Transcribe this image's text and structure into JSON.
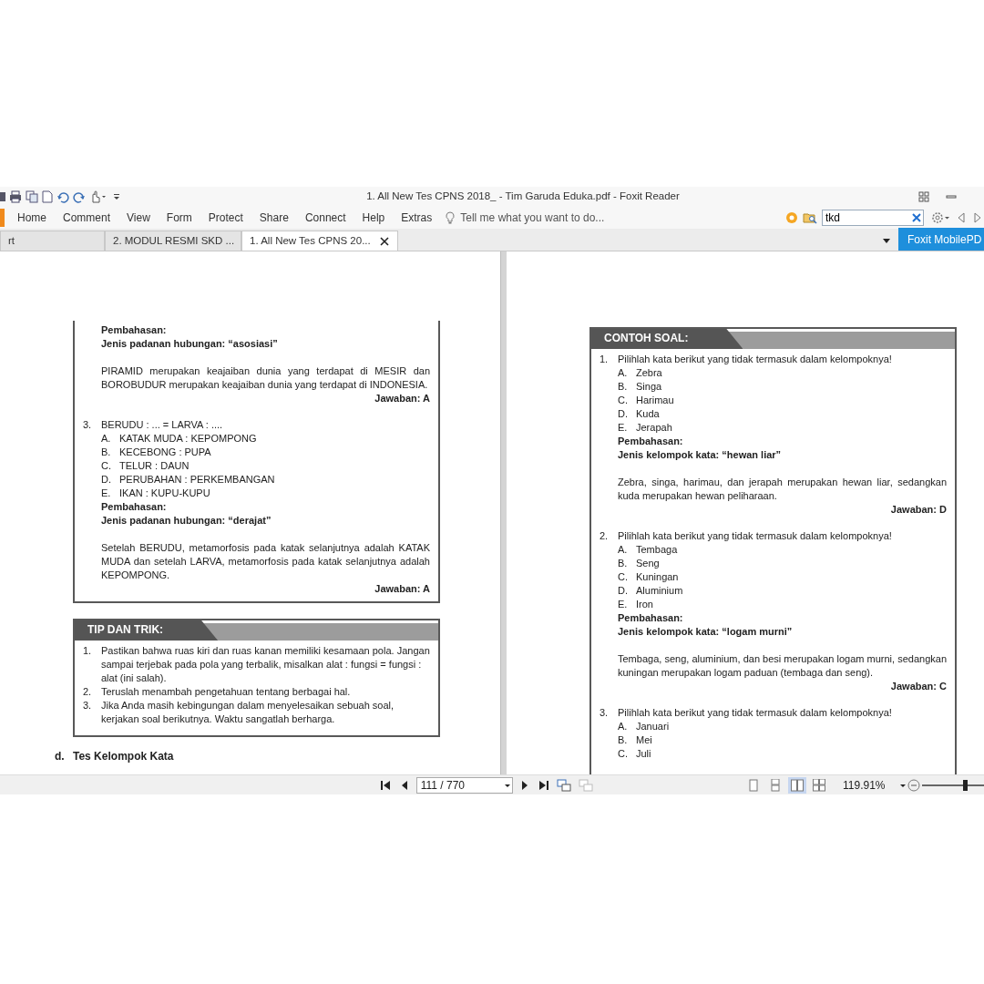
{
  "window": {
    "title": "1. All New Tes CPNS 2018_ - Tim Garuda Eduka.pdf - Foxit Reader"
  },
  "ribbon_tabs": [
    {
      "label": "Home"
    },
    {
      "label": "Comment"
    },
    {
      "label": "View"
    },
    {
      "label": "Form"
    },
    {
      "label": "Protect"
    },
    {
      "label": "Share"
    },
    {
      "label": "Connect"
    },
    {
      "label": "Help"
    },
    {
      "label": "Extras"
    }
  ],
  "tell_me": {
    "placeholder": "Tell me what you want to do..."
  },
  "search": {
    "value": "tkd"
  },
  "doc_tabs": [
    {
      "label": "rt",
      "selected": false
    },
    {
      "label": "2. MODUL RESMI SKD ...",
      "selected": false
    },
    {
      "label": "1. All New Tes CPNS 20...",
      "selected": true
    }
  ],
  "promo": "Foxit MobilePD",
  "left_page": {
    "boxes": [
      {
        "blocks": [
          {
            "kind": "label",
            "text": "Pembahasan:"
          },
          {
            "kind": "label",
            "text": "Jenis padanan hubungan: “asosiasi”"
          },
          {
            "kind": "para",
            "text": "PIRAMID merupakan keajaiban dunia yang terdapat di MESIR dan BOROBUDUR merupakan keajaiban dunia yang terdapat di INDONESIA."
          },
          {
            "kind": "answer",
            "text": "Jawaban: A"
          },
          {
            "kind": "question",
            "number": "3.",
            "text": "BERUDU : ... = LARVA : ...."
          },
          {
            "kind": "option",
            "letter": "A.",
            "text": "KATAK MUDA : KEPOMPONG"
          },
          {
            "kind": "option",
            "letter": "B.",
            "text": "KECEBONG : PUPA"
          },
          {
            "kind": "option",
            "letter": "C.",
            "text": "TELUR : DAUN"
          },
          {
            "kind": "option",
            "letter": "D.",
            "text": "PERUBAHAN : PERKEMBANGAN"
          },
          {
            "kind": "option",
            "letter": "E.",
            "text": "IKAN : KUPU-KUPU"
          },
          {
            "kind": "label",
            "text": "Pembahasan:"
          },
          {
            "kind": "label",
            "text": "Jenis padanan hubungan: “derajat”"
          },
          {
            "kind": "para",
            "text": "Setelah BERUDU, metamorfosis pada katak selanjutnya adalah KATAK MUDA dan setelah LARVA, metamorfosis pada katak selanjutnya adalah KEPOMPONG."
          },
          {
            "kind": "answer",
            "text": "Jawaban: A"
          }
        ]
      },
      {
        "header": "TIP DAN TRIK:",
        "blocks": [
          {
            "kind": "item",
            "number": "1.",
            "text": "Pastikan bahwa ruas kiri dan ruas kanan memiliki kesamaan pola. Jangan sampai terjebak pada pola yang terbalik, misalkan alat : fungsi = fungsi : alat (ini salah)."
          },
          {
            "kind": "item",
            "number": "2.",
            "text": "Teruslah menambah pengetahuan tentang berbagai hal."
          },
          {
            "kind": "item",
            "number": "3.",
            "text": "Jika Anda masih kebingungan dalam menyelesaikan sebuah soal, kerjakan soal berikutnya. Waktu sangatlah berharga."
          }
        ]
      }
    ],
    "section_heading": {
      "number": "d.",
      "text": "Tes Kelompok Kata"
    }
  },
  "right_page": {
    "boxes": [
      {
        "header": "CONTOH SOAL:",
        "blocks": [
          {
            "kind": "question",
            "number": "1.",
            "text": "Pilihlah kata berikut yang tidak termasuk dalam kelompoknya!"
          },
          {
            "kind": "option",
            "letter": "A.",
            "text": "Zebra"
          },
          {
            "kind": "option",
            "letter": "B.",
            "text": "Singa"
          },
          {
            "kind": "option",
            "letter": "C.",
            "text": "Harimau"
          },
          {
            "kind": "option",
            "letter": "D.",
            "text": "Kuda"
          },
          {
            "kind": "option",
            "letter": "E.",
            "text": "Jerapah"
          },
          {
            "kind": "label",
            "text": "Pembahasan:"
          },
          {
            "kind": "label",
            "text": "Jenis kelompok kata: “hewan liar”"
          },
          {
            "kind": "para",
            "text": "Zebra, singa, harimau, dan jerapah merupakan hewan liar, sedangkan kuda merupakan hewan peliharaan."
          },
          {
            "kind": "answer",
            "text": "Jawaban: D"
          },
          {
            "kind": "question",
            "number": "2.",
            "text": "Pilihlah kata berikut yang tidak termasuk dalam kelompoknya!"
          },
          {
            "kind": "option",
            "letter": "A.",
            "text": "Tembaga"
          },
          {
            "kind": "option",
            "letter": "B.",
            "text": "Seng"
          },
          {
            "kind": "option",
            "letter": "C.",
            "text": "Kuningan"
          },
          {
            "kind": "option",
            "letter": "D.",
            "text": "Aluminium"
          },
          {
            "kind": "option",
            "letter": "E.",
            "text": "Iron"
          },
          {
            "kind": "label",
            "text": "Pembahasan:"
          },
          {
            "kind": "label",
            "text": "Jenis kelompok kata: “logam murni”"
          },
          {
            "kind": "para",
            "text": "Tembaga, seng, aluminium, dan besi merupakan logam murni, sedangkan kuningan merupakan logam paduan (tembaga dan seng)."
          },
          {
            "kind": "answer",
            "text": "Jawaban: C"
          },
          {
            "kind": "question",
            "number": "3.",
            "text": "Pilihlah kata berikut yang tidak termasuk dalam kelompoknya!"
          },
          {
            "kind": "option",
            "letter": "A.",
            "text": "Januari"
          },
          {
            "kind": "option",
            "letter": "B.",
            "text": "Mei"
          },
          {
            "kind": "option",
            "letter": "C.",
            "text": "Juli"
          }
        ]
      }
    ]
  },
  "status_bar": {
    "page": "111 / 770",
    "view_modes": [
      {
        "selected": false
      },
      {
        "selected": false
      },
      {
        "selected": true
      },
      {
        "selected": false
      }
    ],
    "zoom": "119.91%",
    "zoom_slider": {
      "level": 0.7
    }
  }
}
